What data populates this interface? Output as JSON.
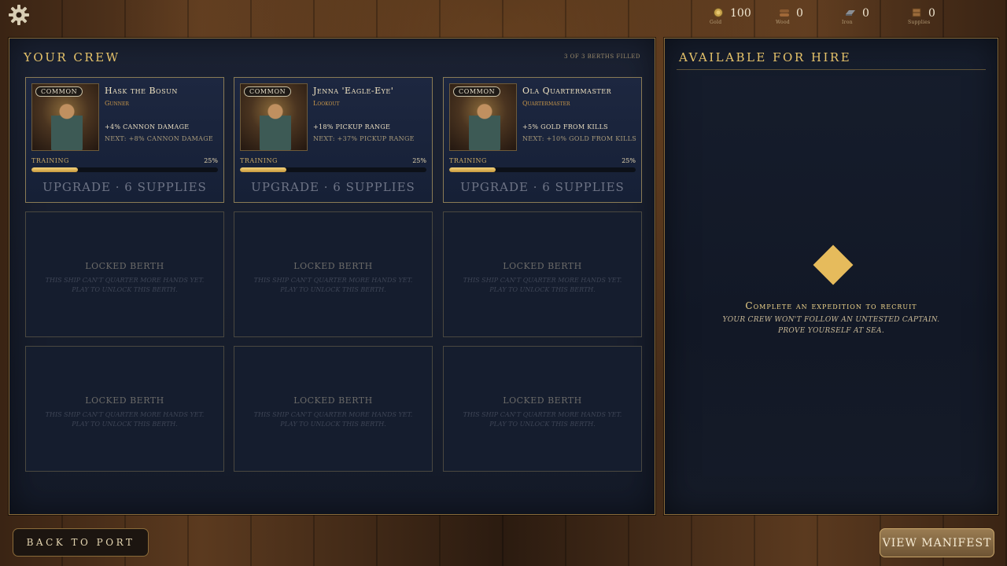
{
  "resources": [
    {
      "icon": "gold-icon",
      "value": "100",
      "label": "Gold"
    },
    {
      "icon": "wood-icon",
      "value": "0",
      "label": "Wood"
    },
    {
      "icon": "iron-icon",
      "value": "0",
      "label": "Iron"
    },
    {
      "icon": "supplies-icon",
      "value": "0",
      "label": "Supplies"
    }
  ],
  "crew_panel": {
    "title": "YOUR CREW",
    "berths_filled": "3 of 3 berths filled"
  },
  "crew": [
    {
      "rarity": "COMMON",
      "name": "Hask the Bosun",
      "role": "Gunner",
      "bonus": "+4% CANNON DAMAGE",
      "next": "NEXT: +8% CANNON DAMAGE",
      "training_label": "TRAINING",
      "training_pct": "25%",
      "training_fraction": 0.25,
      "upgrade": "UPGRADE · 6 SUPPLIES"
    },
    {
      "rarity": "COMMON",
      "name": "Jenna 'Eagle-Eye'",
      "role": "Lookout",
      "bonus": "+18% PICKUP RANGE",
      "next": "NEXT: +37% PICKUP RANGE",
      "training_label": "TRAINING",
      "training_pct": "25%",
      "training_fraction": 0.25,
      "upgrade": "UPGRADE · 6 SUPPLIES"
    },
    {
      "rarity": "COMMON",
      "name": "Ola Quartermaster",
      "role": "Quartermaster",
      "bonus": "+5% GOLD FROM KILLS",
      "next": "NEXT: +10% GOLD FROM KILLS",
      "training_label": "TRAINING",
      "training_pct": "25%",
      "training_fraction": 0.25,
      "upgrade": "UPGRADE · 6 SUPPLIES"
    }
  ],
  "locked": {
    "title": "LOCKED BERTH",
    "line1": "This ship can't quarter more hands yet.",
    "line2": "Play to unlock this berth."
  },
  "hire_panel": {
    "title": "AVAILABLE FOR HIRE",
    "message": "Complete an expedition to recruit",
    "sub1": "Your crew won't follow an untested captain.",
    "sub2": "Prove yourself at sea."
  },
  "buttons": {
    "back": "BACK TO PORT",
    "manifest": "VIEW MANIFEST"
  },
  "colors": {
    "accent_gold": "#e6c36a",
    "panel_bg": "#1b2233",
    "training_fill": "#f4d27a"
  }
}
